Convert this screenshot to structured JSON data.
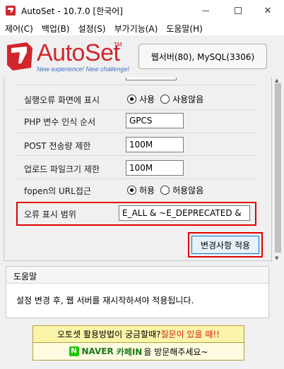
{
  "window": {
    "title": "AutoSet - 10.7.0 [한국어]",
    "close_glyph": "✕"
  },
  "menu": {
    "items": [
      {
        "label": "제어(C)"
      },
      {
        "label": "백업(B)"
      },
      {
        "label": "설정(S)"
      },
      {
        "label": "부가기능(A)"
      },
      {
        "label": "도움말(H)"
      }
    ]
  },
  "header": {
    "logo_text": "AutoSet",
    "logo_tm": "TM",
    "logo_sub": "New experience! New challenge!",
    "server_status": "웹서버(80), MySQL(3306)"
  },
  "settings": {
    "error_display": {
      "label": "실행오류 화면에 표시",
      "options": [
        {
          "label": "사용",
          "selected": true
        },
        {
          "label": "사용않음",
          "selected": false
        }
      ]
    },
    "php_var_order": {
      "label": "PHP 변수 인식 순서",
      "value": "GPCS"
    },
    "post_limit": {
      "label": "POST 전송량 제한",
      "value": "100M"
    },
    "upload_limit": {
      "label": "업로드 파일크기 제한",
      "value": "100M"
    },
    "fopen_url": {
      "label": "fopen의 URL접근",
      "options": [
        {
          "label": "허용",
          "selected": true
        },
        {
          "label": "허용않음",
          "selected": false
        }
      ]
    },
    "error_range": {
      "label": "오류 표시 범위",
      "value": "E_ALL & ~E_DEPRECATED &"
    },
    "apply_label": "변경사항 적용"
  },
  "help": {
    "title": "도움말",
    "text": "설정 변경 후, 웹 서버를 재시작하셔야 적용됩니다."
  },
  "banner": {
    "question_part1": "오토셋 활용방법이 궁금할때? ",
    "question_part2": "질문이 있을 때!!",
    "naver_mark": "N",
    "naver_word": "NAVER",
    "cafe_word": "카페IN",
    "visit_text": "을 방문해주세요~"
  },
  "colors": {
    "logo_red": "#d0262d",
    "highlight_red": "#e00000",
    "accent_blue": "#0078d7"
  }
}
